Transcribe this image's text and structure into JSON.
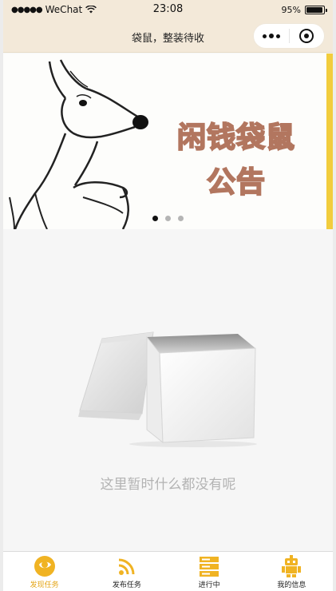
{
  "status_bar": {
    "signal": "●●●●●",
    "carrier": "WeChat",
    "time": "23:08",
    "battery_text": "95%",
    "battery_level": 0.95
  },
  "nav": {
    "title": "袋鼠，整装待收"
  },
  "banner": {
    "title": "闲钱袋鼠",
    "subtitle": "公告",
    "active_index": 0,
    "slide_count": 3
  },
  "empty_state": {
    "message": "这里暂时什么都没有呢"
  },
  "tabs": [
    {
      "label": "发现任务",
      "icon": "eye-icon",
      "active": true
    },
    {
      "label": "发布任务",
      "icon": "rss-icon",
      "active": false
    },
    {
      "label": "进行中",
      "icon": "server-icon",
      "active": false
    },
    {
      "label": "我的信息",
      "icon": "robot-icon",
      "active": false
    }
  ],
  "colors": {
    "accent": "#e5a516",
    "header_bg": "#f3e9d9",
    "banner_text_stroke": "#b2765f"
  }
}
